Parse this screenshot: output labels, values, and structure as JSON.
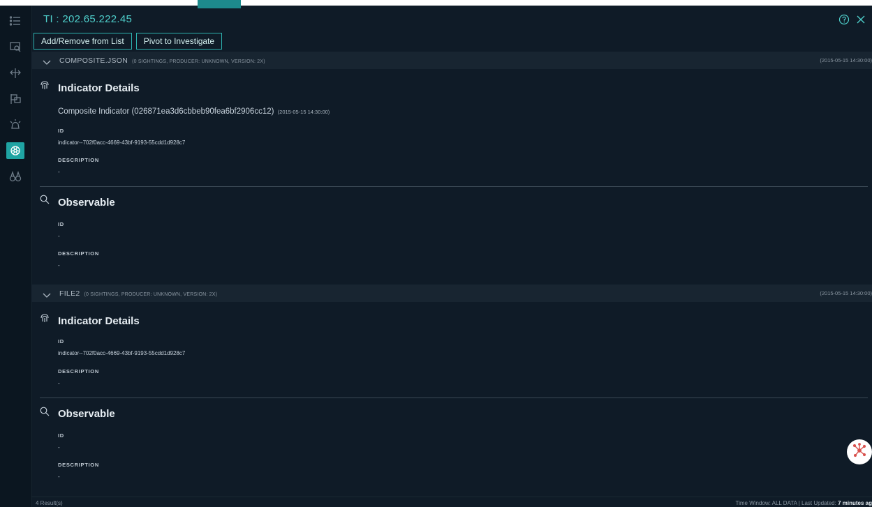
{
  "header": {
    "title": "TI : 202.65.222.45",
    "buttons": {
      "add_remove": "Add/Remove from List",
      "pivot": "Pivot to Investigate"
    }
  },
  "rail": {
    "icons": [
      "list-icon",
      "search-window-icon",
      "pivot-icon",
      "flag-panel-icon",
      "alarm-icon",
      "biohazard-icon",
      "binoculars-icon"
    ],
    "active_color": "#1fa4a3"
  },
  "sections": [
    {
      "name": "COMPOSITE.JSON",
      "meta": "(0 SIGHTINGS, PRODUCER: UNKNOWN, VERSION: 2X)",
      "time": "(2015-05-15 14:30:00)",
      "indicator": {
        "title": "Indicator Details",
        "composite_text": "Composite Indicator (026871ea3d6cbbeb90fea6bf2906cc12)",
        "composite_time": "(2015-05-15 14:30:00)",
        "id_label": "ID",
        "id_value": "indicator--702f0acc-4669-43bf-9193-55cdd1d928c7",
        "desc_label": "DESCRIPTION",
        "desc_value": "-"
      },
      "observable": {
        "title": "Observable",
        "id_label": "ID",
        "id_value": "-",
        "desc_label": "DESCRIPTION",
        "desc_value": "-"
      }
    },
    {
      "name": "FILE2",
      "meta": "(0 SIGHTINGS, PRODUCER: UNKNOWN, VERSION: 2X)",
      "time": "(2015-05-15 14:30:00)",
      "indicator": {
        "title": "Indicator Details",
        "id_label": "ID",
        "id_value": "indicator--702f0acc-4669-43bf-9193-55cdd1d928c7",
        "desc_label": "DESCRIPTION",
        "desc_value": "-"
      },
      "observable": {
        "title": "Observable",
        "id_label": "ID",
        "id_value": "-",
        "desc_label": "DESCRIPTION",
        "desc_value": "-"
      }
    }
  ],
  "footer": {
    "count": "4 Result(s)",
    "window_text": "Time Window: ALL DATA | Last Updated:",
    "updated": "7 minutes ag"
  },
  "colors": {
    "accent": "#4fd0cc",
    "background": "#0f1b27",
    "section_header": "#182531"
  }
}
